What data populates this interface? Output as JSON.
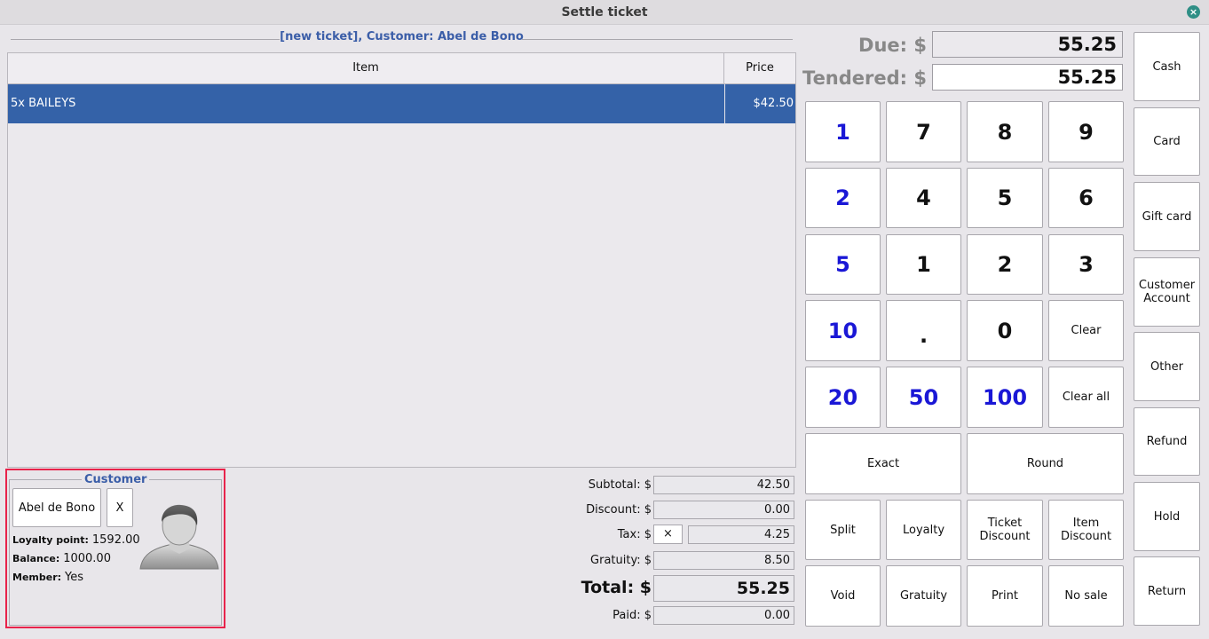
{
  "window": {
    "title": "Settle ticket",
    "close_glyph": "×"
  },
  "ticket": {
    "header": "[new ticket], Customer: Abel de Bono",
    "columns": {
      "item": "Item",
      "price": "Price"
    },
    "rows": [
      {
        "item": "5x BAILEYS",
        "price": "$42.50"
      }
    ]
  },
  "customer": {
    "title": "Customer",
    "name": "Abel de Bono",
    "remove_label": "X",
    "loyalty_label": "Loyalty point:",
    "loyalty_value": "1592.00",
    "balance_label": "Balance:",
    "balance_value": "1000.00",
    "member_label": "Member:",
    "member_value": "Yes"
  },
  "totals": {
    "subtotal_label": "Subtotal: $",
    "subtotal": "42.50",
    "discount_label": "Discount: $",
    "discount": "0.00",
    "tax_label": "Tax: $",
    "tax_toggle": "×",
    "tax": "4.25",
    "gratuity_label": "Gratuity: $",
    "gratuity": "8.50",
    "total_label": "Total: $",
    "total": "55.25",
    "paid_label": "Paid: $",
    "paid": "0.00"
  },
  "payment_entry": {
    "due_label": "Due: $",
    "due": "55.25",
    "tendered_label": "Tendered: $",
    "tendered": "55.25"
  },
  "keypad": {
    "quick_amounts": [
      "1",
      "2",
      "5",
      "10",
      "20",
      "50",
      "100"
    ],
    "digits": [
      "7",
      "8",
      "9",
      "4",
      "5",
      "6",
      "1",
      "2",
      "3",
      ".",
      "0"
    ],
    "clear": "Clear",
    "clear_all": "Clear all",
    "exact": "Exact",
    "round": "Round"
  },
  "actions": {
    "split": "Split",
    "loyalty": "Loyalty",
    "ticket_discount": "Ticket Discount",
    "item_discount": "Item Discount",
    "void": "Void",
    "gratuity": "Gratuity",
    "print": "Print",
    "no_sale": "No sale"
  },
  "payment_methods": {
    "cash": "Cash",
    "card": "Card",
    "gift_card": "Gift card",
    "customer_account": "Customer Account",
    "other": "Other",
    "refund": "Refund",
    "hold": "Hold",
    "return": "Return"
  },
  "colors": {
    "selected_row": "#3462a8",
    "header_text": "#3b5ea8",
    "quick_amount_text": "#1a17d6",
    "highlight_border": "#e8234b"
  }
}
